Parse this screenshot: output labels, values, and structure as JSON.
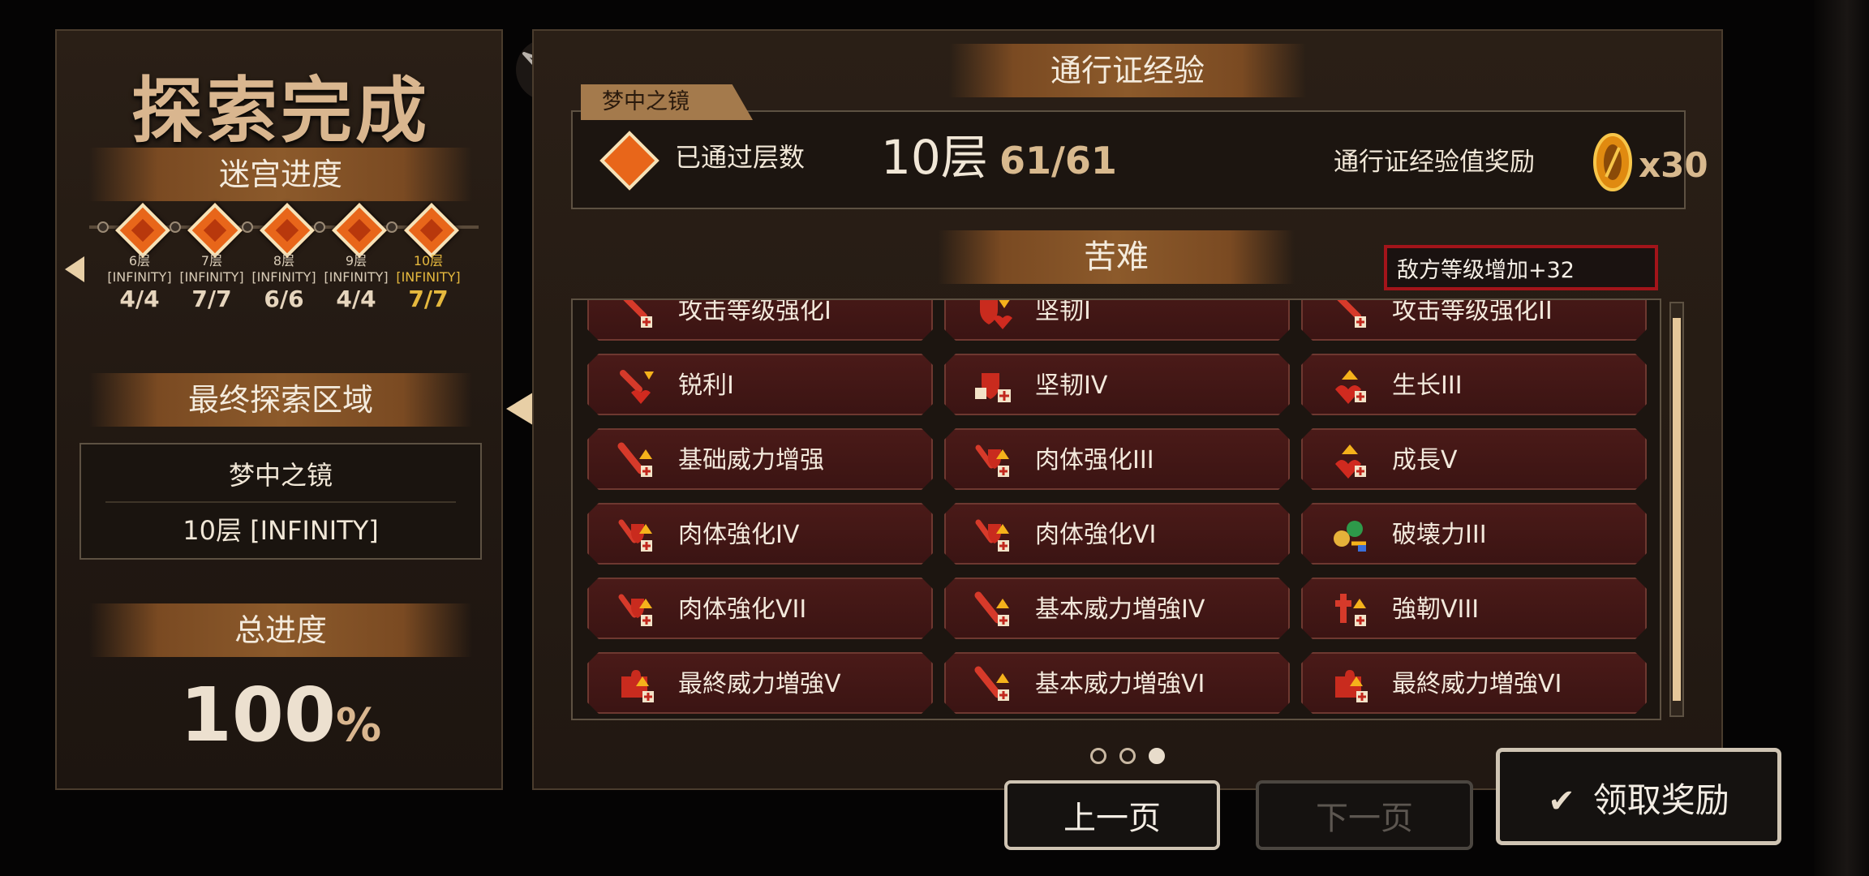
{
  "left": {
    "title": "探索完成",
    "maze_progress_title": "迷宫进度",
    "floors": [
      {
        "floor": "6层",
        "mode": "[INFINITY]",
        "count": "4/4",
        "active": false
      },
      {
        "floor": "7层",
        "mode": "[INFINITY]",
        "count": "7/7",
        "active": false
      },
      {
        "floor": "8层",
        "mode": "[INFINITY]",
        "count": "6/6",
        "active": false
      },
      {
        "floor": "9层",
        "mode": "[INFINITY]",
        "count": "4/4",
        "active": false
      },
      {
        "floor": "10层",
        "mode": "[INFINITY]",
        "count": "7/7",
        "active": true
      }
    ],
    "final_area_title": "最终探索区域",
    "final_area_name": "梦中之镜",
    "final_area_floor": "10层 [INFINITY]",
    "total_progress_title": "总进度",
    "total_progress_value": "100",
    "total_progress_unit": "%"
  },
  "pass": {
    "title": "通行证经验",
    "tag": "梦中之镜",
    "cleared_label": "已通过层数",
    "cleared_value": "10层",
    "cleared_ratio": "61/61",
    "reward_label": "通行证经验值奖励",
    "reward_amount": "x30"
  },
  "hardship": {
    "title": "苦难",
    "enemy_level": "敌方等级增加+32",
    "cards": [
      {
        "label": "攻击等级强化I",
        "icon": "sword-plus-icon"
      },
      {
        "label": "坚韧I",
        "icon": "shield-heart-icon"
      },
      {
        "label": "攻击等级强化II",
        "icon": "sword-plus-icon"
      },
      {
        "label": "锐利I",
        "icon": "sword-heart-icon"
      },
      {
        "label": "坚韧IV",
        "icon": "shield-plus-icon"
      },
      {
        "label": "生长III",
        "icon": "heart-up-icon"
      },
      {
        "label": "基础威力增强",
        "icon": "sword-up-icon"
      },
      {
        "label": "肉体强化III",
        "icon": "body-plus-icon"
      },
      {
        "label": "成長V",
        "icon": "heart-up-icon"
      },
      {
        "label": "肉体強化IV",
        "icon": "body-plus-icon"
      },
      {
        "label": "肉体強化VI",
        "icon": "body-plus-icon"
      },
      {
        "label": "破壊力III",
        "icon": "clover-key-icon"
      },
      {
        "label": "肉体強化VII",
        "icon": "body-plus-icon"
      },
      {
        "label": "基本威力増強IV",
        "icon": "sword-up-icon"
      },
      {
        "label": "強靭VIII",
        "icon": "cross-plus-icon"
      },
      {
        "label": "最終威力増強V",
        "icon": "puzzle-up-icon"
      },
      {
        "label": "基本威力増強VI",
        "icon": "sword-up-icon"
      },
      {
        "label": "最終威力増強VI",
        "icon": "puzzle-up-icon"
      }
    ]
  },
  "pagination": {
    "pages": 3,
    "current": 3
  },
  "buttons": {
    "prev": "上一页",
    "next": "下一页",
    "claim": "领取奖励"
  },
  "colors": {
    "accent_gold": "#e6b93e",
    "card_red": "#4a1a18",
    "enemy_border": "#a3141a"
  }
}
